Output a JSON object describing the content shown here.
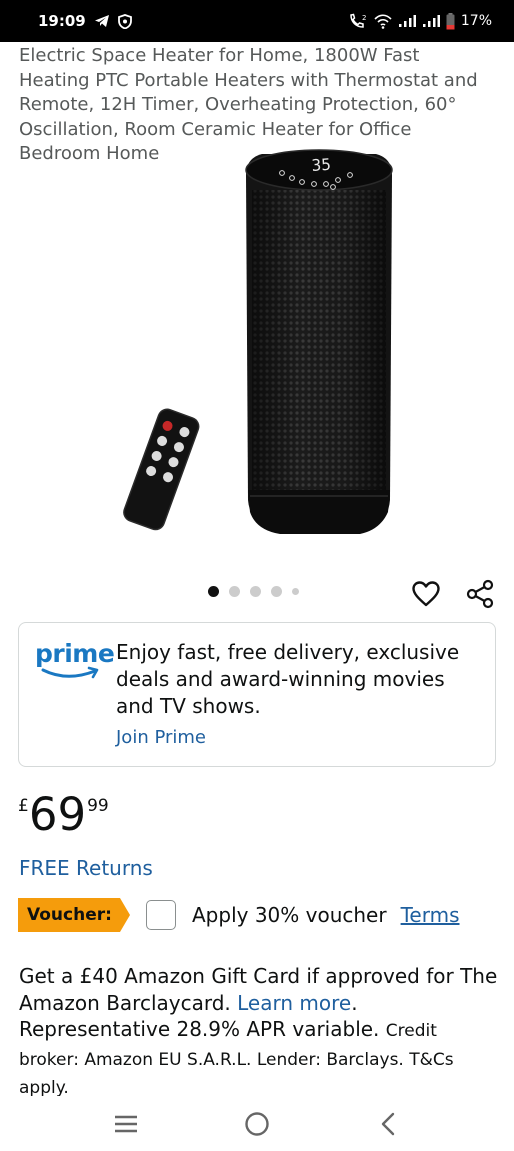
{
  "status_bar": {
    "time": "19:09",
    "battery": "17%",
    "icons": [
      "telegram-icon",
      "shield-icon",
      "wifi-calling-icon",
      "wifi-icon",
      "signal-icon",
      "signal-icon",
      "battery-icon"
    ]
  },
  "product": {
    "title": "Electric Space Heater for Home, 1800W Fast Heating PTC Portable Heaters with Thermostat and Remote, 12H Timer, Overheating Protection, 60° Oscillation, Room Ceramic Heater for Office Bedroom Home",
    "display_readout": "35",
    "image_count": 5,
    "active_image_index": 0
  },
  "prime": {
    "logo": "prime",
    "text": "Enjoy fast, free delivery, exclusive deals and award-winning movies and TV shows.",
    "link": "Join Prime",
    "colors": {
      "logo": "#1a78c2",
      "link": "#1f5f9e"
    }
  },
  "price": {
    "currency": "£",
    "whole": "69",
    "fraction": "99"
  },
  "free_returns": "FREE Returns",
  "voucher": {
    "badge": "Voucher:",
    "text": "Apply 30% voucher",
    "terms": "Terms",
    "checked": false,
    "badge_color": "#f59c0c"
  },
  "offer": {
    "line1": "Get a £40 Amazon Gift Card if approved for The Amazon Barclaycard.",
    "link": "Learn more",
    "period": ".",
    "apr": "Representative 28.9% APR variable.",
    "broker": "Credit broker: Amazon EU S.A.R.L. Lender: Barclays. T&Cs apply."
  },
  "nav": {
    "icons": [
      "recent-apps-icon",
      "home-icon",
      "back-icon"
    ]
  }
}
